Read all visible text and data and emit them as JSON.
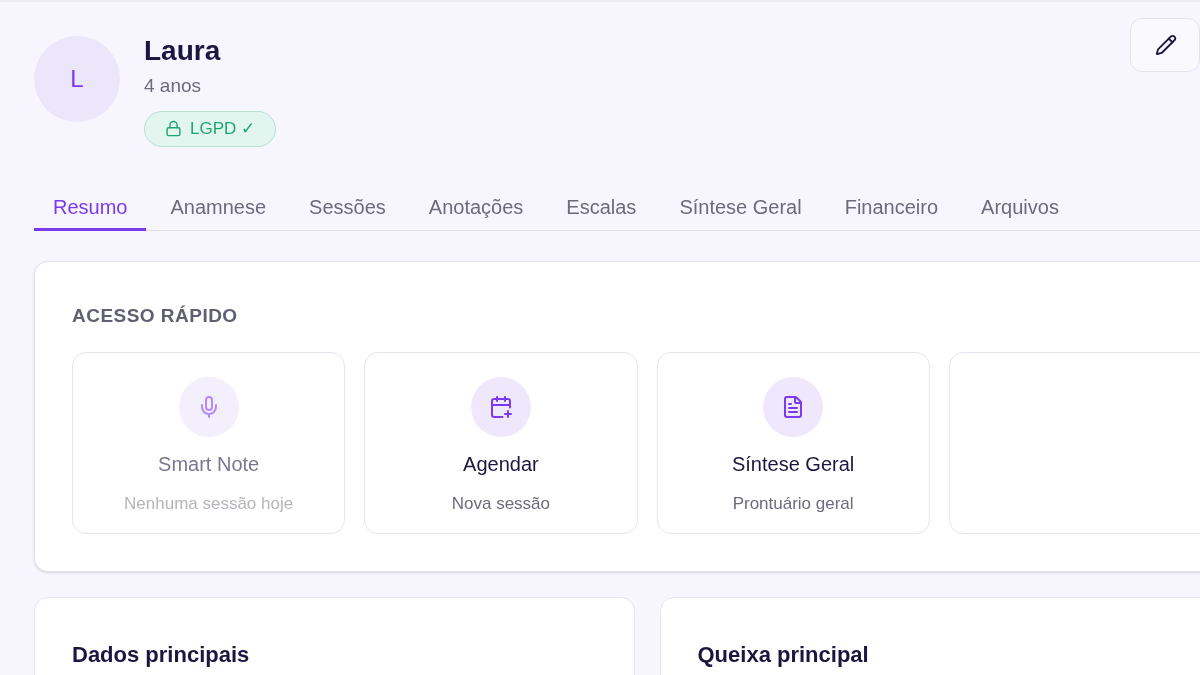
{
  "patient": {
    "initial": "L",
    "name": "Laura",
    "age": "4 anos",
    "badge": "LGPD ✓"
  },
  "tabs": [
    {
      "label": "Resumo",
      "selected": true
    },
    {
      "label": "Anamnese",
      "selected": false
    },
    {
      "label": "Sessões",
      "selected": false
    },
    {
      "label": "Anotações",
      "selected": false
    },
    {
      "label": "Escalas",
      "selected": false
    },
    {
      "label": "Síntese Geral",
      "selected": false
    },
    {
      "label": "Financeiro",
      "selected": false
    },
    {
      "label": "Arquivos",
      "selected": false
    }
  ],
  "quick_access": {
    "title": "ACESSO RÁPIDO",
    "items": [
      {
        "kind": "microphone",
        "title": "Smart Note",
        "subtitle": "Nenhuma sessão hoje",
        "disabled": true
      },
      {
        "kind": "calendar",
        "title": "Agendar",
        "subtitle": "Nova sessão",
        "disabled": false
      },
      {
        "kind": "document",
        "title": "Síntese Geral",
        "subtitle": "Prontuário geral",
        "disabled": false
      }
    ]
  },
  "panels": [
    {
      "title": "Dados principais"
    },
    {
      "title": "Queixa principal"
    }
  ]
}
